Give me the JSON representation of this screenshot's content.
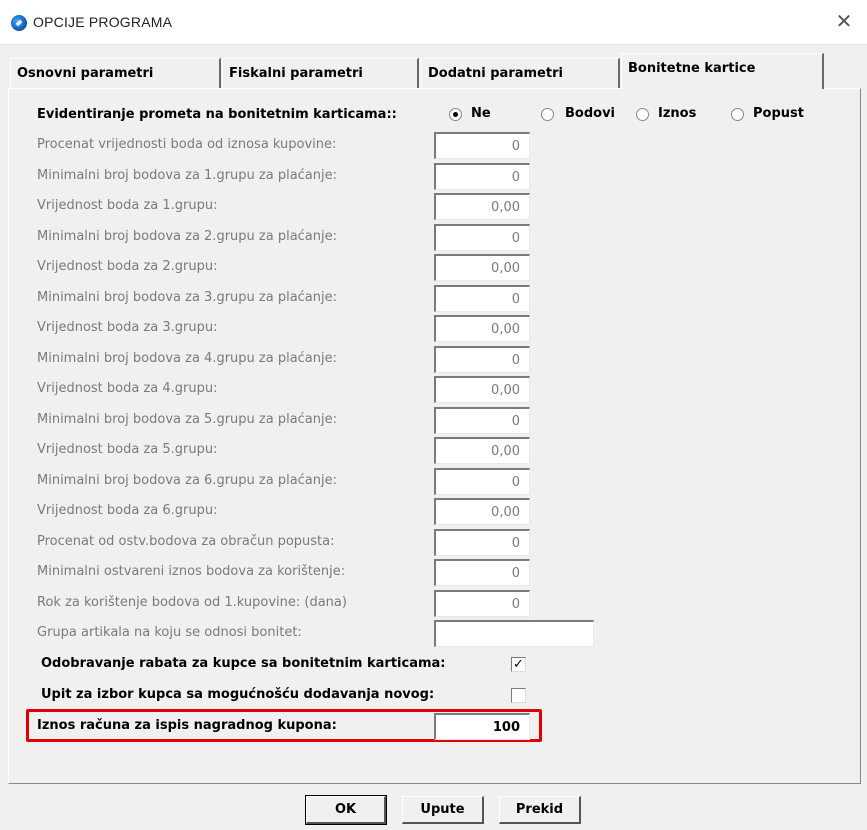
{
  "window": {
    "title": "OPCIJE PROGRAMA",
    "close_glyph": "✕"
  },
  "tabs": [
    {
      "label": "Osnovni parametri"
    },
    {
      "label": "Fiskalni parametri"
    },
    {
      "label": "Dodatni parametri"
    },
    {
      "label": "Bonitetne kartice"
    }
  ],
  "tracking": {
    "label": "Evidentiranje prometa na bonitetnim karticama::",
    "options": [
      {
        "label": "Ne",
        "selected": true
      },
      {
        "label": "Bodovi",
        "selected": false
      },
      {
        "label": "Iznos",
        "selected": false
      },
      {
        "label": "Popust",
        "selected": false
      }
    ]
  },
  "fields": [
    {
      "label": "Procenat vrijednosti boda od iznosa kupovine:",
      "value": "0"
    },
    {
      "label": "Minimalni broj bodova za 1.grupu za plaćanje:",
      "value": "0"
    },
    {
      "label": "Vrijednost boda za 1.grupu:",
      "value": "0,00"
    },
    {
      "label": "Minimalni broj bodova za 2.grupu za plaćanje:",
      "value": "0"
    },
    {
      "label": "Vrijednost boda za 2.grupu:",
      "value": "0,00"
    },
    {
      "label": "Minimalni broj bodova za 3.grupu za plaćanje:",
      "value": "0"
    },
    {
      "label": "Vrijednost boda za 3.grupu:",
      "value": "0,00"
    },
    {
      "label": "Minimalni broj bodova za 4.grupu za plaćanje:",
      "value": "0"
    },
    {
      "label": "Vrijednost boda za 4.grupu:",
      "value": "0,00"
    },
    {
      "label": "Minimalni broj bodova za 5.grupu za plaćanje:",
      "value": "0"
    },
    {
      "label": "Vrijednost boda za 5.grupu:",
      "value": "0,00"
    },
    {
      "label": "Minimalni broj bodova za 6.grupu za plaćanje:",
      "value": "0"
    },
    {
      "label": "Vrijednost boda za 6.grupu:",
      "value": "0,00"
    },
    {
      "label": "Procenat od ostv.bodova za obračun popusta:",
      "value": "0"
    },
    {
      "label": "Minimalni ostvareni iznos bodova za korištenje:",
      "value": "0"
    },
    {
      "label": "Rok za korištenje bodova od 1.kupovine: (dana)",
      "value": "0"
    },
    {
      "label": "Grupa artikala na koju se odnosi bonitet:",
      "value": ""
    }
  ],
  "checkboxes": [
    {
      "label": "Odobravanje rabata za kupce sa bonitetnim karticama:",
      "checked": true,
      "mark": "✓"
    },
    {
      "label": "Upit za izbor kupca sa mogućnošću dodavanja novog:",
      "checked": false,
      "mark": ""
    }
  ],
  "coupon": {
    "label": "Iznos računa za ispis nagradnog kupona:",
    "value": "100",
    "highlight_color": "#e10000"
  },
  "buttons": {
    "ok": "OK",
    "help": "Upute",
    "cancel": "Prekid"
  }
}
